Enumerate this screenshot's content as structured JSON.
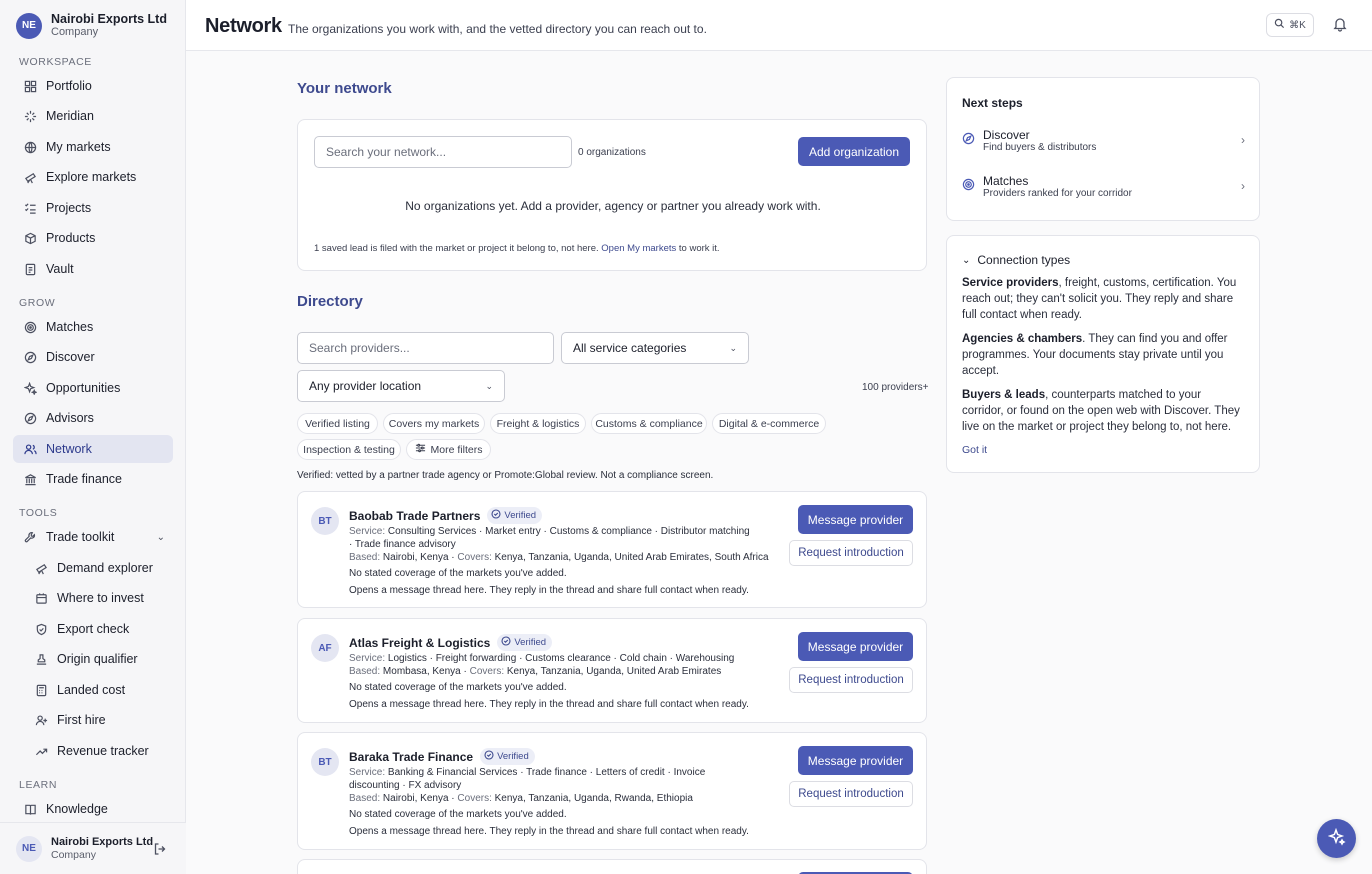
{
  "sidebar": {
    "org": {
      "initials": "NE",
      "name": "Nairobi Exports Ltd",
      "type": "Company"
    },
    "sections": {
      "workspace": "WORKSPACE",
      "grow": "GROW",
      "tools": "TOOLS",
      "learn": "LEARN"
    },
    "workspace": [
      "Portfolio",
      "Meridian",
      "My markets",
      "Explore markets",
      "Projects",
      "Products",
      "Vault"
    ],
    "grow": [
      "Matches",
      "Discover",
      "Opportunities",
      "Advisors",
      "Network",
      "Trade finance"
    ],
    "tools": {
      "group": "Trade toolkit",
      "items": [
        "Demand explorer",
        "Where to invest",
        "Export check",
        "Origin qualifier",
        "Landed cost",
        "First hire",
        "Revenue tracker"
      ]
    },
    "learn": [
      "Knowledge"
    ],
    "footer": {
      "initials": "NE",
      "name": "Nairobi Exports Ltd",
      "type": "Company"
    }
  },
  "header": {
    "title": "Network",
    "subtitle": "The organizations you work with, and the vetted directory you can reach out to.",
    "shortcut": "⌘K"
  },
  "your_network": {
    "title": "Your network",
    "search_placeholder": "Search your network...",
    "count": "0 organizations",
    "add_button": "Add organization",
    "empty": "No organizations yet. Add a provider, agency or partner you already work with.",
    "note_pre": "1 saved lead is filed with the market or project it belong to, not here.",
    "note_link": "Open My markets",
    "note_post": "to work it."
  },
  "directory": {
    "title": "Directory",
    "search_placeholder": "Search providers...",
    "category": "All service categories",
    "location": "Any provider location",
    "count": "100 providers+",
    "chips": [
      "Verified listing",
      "Covers my markets",
      "Freight & logistics",
      "Customs & compliance",
      "Digital & e-commerce",
      "Inspection & testing"
    ],
    "more_filters": "More filters",
    "verified_note": "Verified: vetted by a partner trade agency or Promote:Global review. Not a compliance screen.",
    "labels": {
      "service": "Service:",
      "based": "Based:",
      "covers": "Covers:",
      "verified": "Verified",
      "message": "Message provider",
      "intro": "Request introduction"
    },
    "providers": [
      {
        "initials": "BT",
        "name": "Baobab Trade Partners",
        "service": "Consulting Services · Market entry · Customs & compliance · Distributor matching · Trade finance advisory",
        "based": "Nairobi, Kenya",
        "covers": "Kenya, Tanzania, Uganda, United Arab Emirates, South Africa",
        "coverage": "No stated coverage of the markets you've added.",
        "thread": "Opens a message thread here. They reply in the thread and share full contact when ready."
      },
      {
        "initials": "AF",
        "name": "Atlas Freight & Logistics",
        "service": "Logistics · Freight forwarding · Customs clearance · Cold chain · Warehousing",
        "based": "Mombasa, Kenya",
        "covers": "Kenya, Tanzania, Uganda, United Arab Emirates",
        "coverage": "No stated coverage of the markets you've added.",
        "thread": "Opens a message thread here. They reply in the thread and share full contact when ready."
      },
      {
        "initials": "BT",
        "name": "Baraka Trade Finance",
        "service": "Banking & Financial Services · Trade finance · Letters of credit · Invoice discounting · FX advisory",
        "based": "Nairobi, Kenya",
        "covers": "Kenya, Tanzania, Uganda, Rwanda, Ethiopia",
        "coverage": "No stated coverage of the markets you've added.",
        "thread": "Opens a message thread here. They reply in the thread and share full contact when ready."
      }
    ]
  },
  "next_steps": {
    "title": "Next steps",
    "items": [
      {
        "title": "Discover",
        "sub": "Find buyers & distributors"
      },
      {
        "title": "Matches",
        "sub": "Providers ranked for your corridor"
      }
    ]
  },
  "connection_types": {
    "title": "Connection types",
    "p1b": "Service providers",
    "p1": ", freight, customs, certification. You reach out; they can't solicit you. They reply and share full contact when ready.",
    "p2b": "Agencies & chambers",
    "p2": ". They can find you and offer programmes. Your documents stay private until you accept.",
    "p3b": "Buyers & leads",
    "p3": ", counterparts matched to your corridor, or found on the open web with Discover. They live on the market or project they belong to, not here.",
    "got_it": "Got it"
  },
  "colors": {
    "accent": "#4b5ab5",
    "heading": "#3e4a8e",
    "active_bg": "#e3e5f1"
  }
}
